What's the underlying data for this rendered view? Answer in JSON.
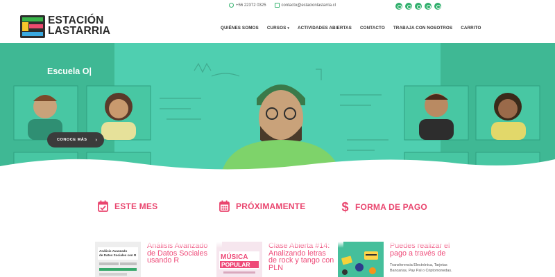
{
  "brand": {
    "line1": "ESTACIÓN",
    "line2": "LASTARRIA"
  },
  "contact": {
    "phone": "+56 22372 0325",
    "email": "contacto@estacionlastarria.cl"
  },
  "socials": [
    "instagram-icon",
    "twitter-icon",
    "facebook-icon",
    "mail-icon",
    "spotify-icon"
  ],
  "nav": {
    "items": [
      "QUIÉNES SOMOS",
      "CURSOS",
      "ACTIVIDADES ABIERTAS",
      "CONTACTO",
      "TRABAJA CON NOSOTROS",
      "CARRITO"
    ],
    "dropdown_caret": "▾"
  },
  "hero": {
    "title": "Escuela O|",
    "cta_label": "CONOCE MÁS",
    "cta_arrow": "›"
  },
  "features": [
    {
      "label": "ESTE MES",
      "icon": "calendar-check-icon"
    },
    {
      "label": "PRÓXIMAMENTE",
      "icon": "calendar-grid-icon"
    },
    {
      "label": "FORMA DE PAGO",
      "icon": "dollar-icon"
    }
  ],
  "cards": [
    {
      "title": "Análisis Avanzado de Datos Sociales usando R",
      "thumb_text": "Análisis Avanzado de Datos Sociales con R"
    },
    {
      "title": "Clase Abierta #14: Analizando letras de rock y tango con PLN",
      "thumb_text": "MÚSICA POPULAR"
    },
    {
      "title": "Puedes realizar el pago a través de",
      "text": "Transferencia Electrónica, Tarjetas Bancarias, Pay Pal o Criptomonedas."
    }
  ],
  "colors": {
    "accent": "#e9456e",
    "green": "#31b06d",
    "hero": "#52cfb0",
    "dark_button": "#3b3b3b"
  }
}
